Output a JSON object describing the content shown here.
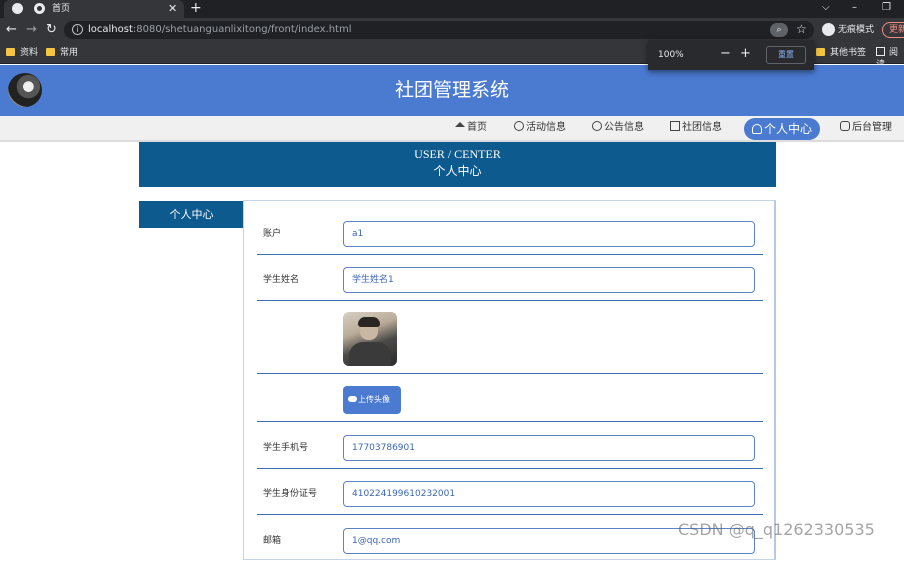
{
  "browser": {
    "tab_title": "首页",
    "url_host": "localhost",
    "url_rest": ":8080/shetuanguanlixitong/front/index.html",
    "incognito_label": "无痕模式",
    "update_label": "更新",
    "bookmarks": [
      "资料",
      "常用"
    ],
    "bookmarks_right": [
      "其他书签",
      "阅读"
    ],
    "zoom": {
      "value": "100%",
      "reset_label": "重置"
    }
  },
  "site": {
    "title": "社团管理系统",
    "nav": [
      {
        "label": "首页",
        "icon": "home-icon"
      },
      {
        "label": "活动信息",
        "icon": "activity-icon"
      },
      {
        "label": "公告信息",
        "icon": "notice-icon"
      },
      {
        "label": "社团信息",
        "icon": "club-icon"
      },
      {
        "label": "个人中心",
        "icon": "user-icon",
        "active": true
      },
      {
        "label": "后台管理",
        "icon": "link-icon"
      }
    ],
    "accent_color": "#4b7ad1",
    "banner_color": "#0d5a8e"
  },
  "banner": {
    "en": "USER / CENTER",
    "cn": "个人中心"
  },
  "sidebar": {
    "tab_label": "个人中心"
  },
  "form": {
    "account": {
      "label": "账户",
      "value": "a1"
    },
    "student_name": {
      "label": "学生姓名",
      "value": "学生姓名1"
    },
    "upload_label": "上传头像",
    "phone": {
      "label": "学生手机号",
      "value": "17703786901"
    },
    "id_card": {
      "label": "学生身份证号",
      "value": "410224199610232001"
    },
    "email": {
      "label": "邮箱",
      "value": "1@qq.com"
    }
  },
  "watermark": "CSDN @q_q1262330535"
}
